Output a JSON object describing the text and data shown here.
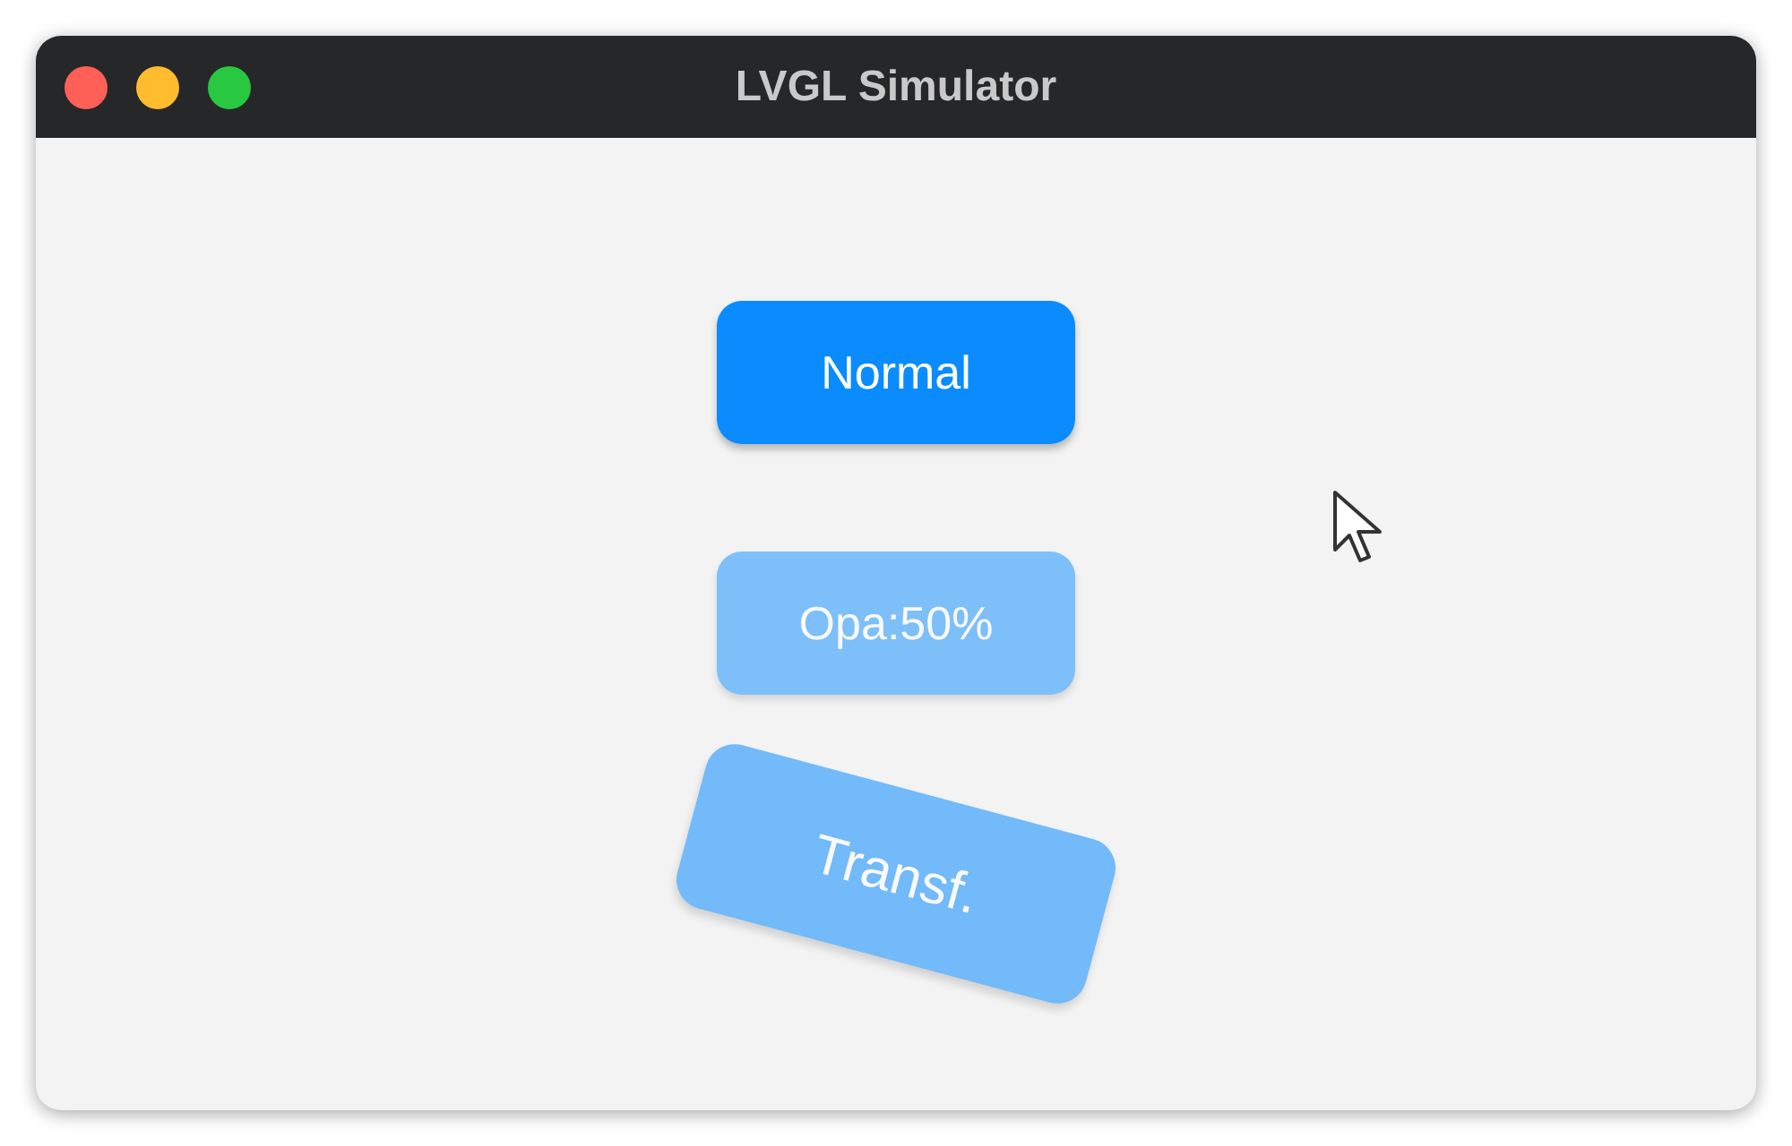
{
  "window": {
    "title": "LVGL Simulator"
  },
  "buttons": [
    {
      "label": "Normal",
      "kind": "normal"
    },
    {
      "label": "Opa:50%",
      "kind": "translucent"
    },
    {
      "label": "Transf.",
      "kind": "transformed"
    }
  ]
}
